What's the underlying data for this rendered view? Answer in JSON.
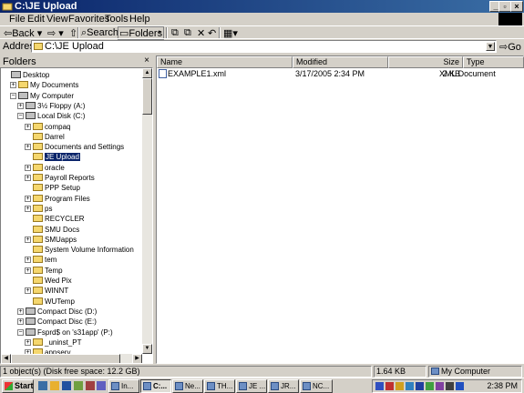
{
  "window": {
    "title": "C:\\JE Upload"
  },
  "menu": [
    "File",
    "Edit",
    "View",
    "Favorites",
    "Tools",
    "Help"
  ],
  "toolbar": {
    "back": "Back",
    "search": "Search",
    "folders": "Folders"
  },
  "address": {
    "label": "Address",
    "value": "C:\\JE Upload",
    "go": "Go"
  },
  "folders_pane": {
    "title": "Folders",
    "close": "×",
    "items": [
      {
        "label": "Desktop",
        "depth": 0,
        "expander": "",
        "kind": "desktop"
      },
      {
        "label": "My Documents",
        "depth": 1,
        "expander": "+",
        "kind": "folder"
      },
      {
        "label": "My Computer",
        "depth": 1,
        "expander": "−",
        "kind": "computer"
      },
      {
        "label": "3½ Floppy (A:)",
        "depth": 2,
        "expander": "+",
        "kind": "drive"
      },
      {
        "label": "Local Disk (C:)",
        "depth": 2,
        "expander": "−",
        "kind": "drive"
      },
      {
        "label": "compaq",
        "depth": 3,
        "expander": "+",
        "kind": "folder"
      },
      {
        "label": "Darrel",
        "depth": 3,
        "expander": "",
        "kind": "folder"
      },
      {
        "label": "Documents and Settings",
        "depth": 3,
        "expander": "+",
        "kind": "folder"
      },
      {
        "label": "JE Upload",
        "depth": 3,
        "expander": "",
        "kind": "folder",
        "selected": true
      },
      {
        "label": "oracle",
        "depth": 3,
        "expander": "+",
        "kind": "folder"
      },
      {
        "label": "Payroll Reports",
        "depth": 3,
        "expander": "+",
        "kind": "folder"
      },
      {
        "label": "PPP Setup",
        "depth": 3,
        "expander": "",
        "kind": "folder"
      },
      {
        "label": "Program Files",
        "depth": 3,
        "expander": "+",
        "kind": "folder"
      },
      {
        "label": "ps",
        "depth": 3,
        "expander": "+",
        "kind": "folder"
      },
      {
        "label": "RECYCLER",
        "depth": 3,
        "expander": "",
        "kind": "folder"
      },
      {
        "label": "SMU Docs",
        "depth": 3,
        "expander": "",
        "kind": "folder"
      },
      {
        "label": "SMUapps",
        "depth": 3,
        "expander": "+",
        "kind": "folder"
      },
      {
        "label": "System Volume Information",
        "depth": 3,
        "expander": "",
        "kind": "folder"
      },
      {
        "label": "tem",
        "depth": 3,
        "expander": "+",
        "kind": "folder"
      },
      {
        "label": "Temp",
        "depth": 3,
        "expander": "+",
        "kind": "folder"
      },
      {
        "label": "Wed Pix",
        "depth": 3,
        "expander": "",
        "kind": "folder"
      },
      {
        "label": "WINNT",
        "depth": 3,
        "expander": "+",
        "kind": "folder"
      },
      {
        "label": "WUTemp",
        "depth": 3,
        "expander": "",
        "kind": "folder"
      },
      {
        "label": "Compact Disc (D:)",
        "depth": 2,
        "expander": "+",
        "kind": "drive"
      },
      {
        "label": "Compact Disc (E:)",
        "depth": 2,
        "expander": "+",
        "kind": "drive"
      },
      {
        "label": "Fsprd$ on 's31app' (P:)",
        "depth": 2,
        "expander": "−",
        "kind": "drive"
      },
      {
        "label": "_uninst_PT",
        "depth": 3,
        "expander": "+",
        "kind": "folder"
      },
      {
        "label": "appserv",
        "depth": 3,
        "expander": "+",
        "kind": "folder"
      }
    ]
  },
  "columns": {
    "name": "Name",
    "modified": "Modified",
    "size": "Size",
    "type": "Type"
  },
  "files": [
    {
      "name": "EXAMPLE1.xml",
      "modified": "3/17/2005 2:34 PM",
      "size": "2 KB",
      "type": "XML Document"
    }
  ],
  "status": {
    "left": "1 object(s) (Disk free space: 12.2 GB)",
    "size": "1.64 KB",
    "location": "My Computer"
  },
  "taskbar": {
    "start": "Start",
    "tasks": [
      "In...",
      "C:...",
      "Ne...",
      "TH...",
      "JE ...",
      "JR...",
      "NC..."
    ],
    "clock": "2:38 PM"
  },
  "colors": {
    "title_active": "#0a246a",
    "selection": "#0a246a",
    "face": "#d4d0c8"
  }
}
